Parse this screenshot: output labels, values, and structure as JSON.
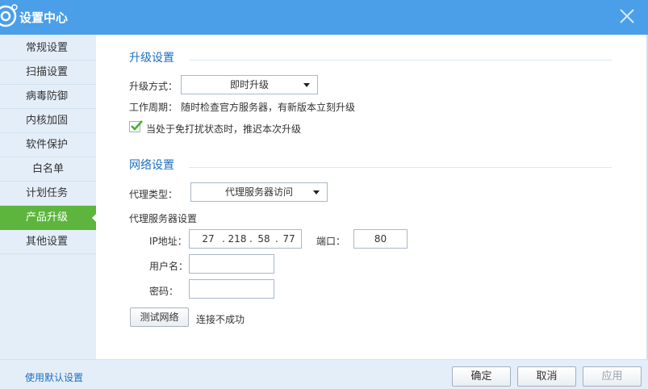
{
  "window": {
    "title": "设置中心",
    "accent_color": "#4a9fe8",
    "active_color": "#5db53d"
  },
  "sidebar": {
    "items": [
      {
        "label": "常规设置"
      },
      {
        "label": "扫描设置"
      },
      {
        "label": "病毒防御"
      },
      {
        "label": "内核加固"
      },
      {
        "label": "软件保护"
      },
      {
        "label": "白名单"
      },
      {
        "label": "计划任务"
      },
      {
        "label": "产品升级",
        "active": true
      },
      {
        "label": "其他设置"
      }
    ]
  },
  "upgrade": {
    "section_title": "升级设置",
    "method_label": "升级方式：",
    "method_value": "即时升级",
    "cycle_label": "工作周期：",
    "cycle_text": "随时检查官方服务器，有新版本立刻升级",
    "defer_checkbox_label": "当处于免打扰状态时，推迟本次升级",
    "defer_checked": true
  },
  "network": {
    "section_title": "网络设置",
    "proxy_type_label": "代理类型：",
    "proxy_type_value": "代理服务器访问",
    "proxy_server_label": "代理服务器设置",
    "ip_label": "IP地址：",
    "ip": [
      "27",
      "218",
      "58",
      "77"
    ],
    "port_label": "端口：",
    "port_value": "80",
    "username_label": "用户名：",
    "username_value": "",
    "password_label": "密码：",
    "password_value": "",
    "test_button": "测试网络",
    "test_status": "连接不成功"
  },
  "footer": {
    "default_link": "使用默认设置",
    "ok": "确定",
    "cancel": "取消",
    "apply": "应用"
  },
  "icons": {
    "logo": "gear-logo-icon",
    "close": "close-icon",
    "dropdown": "caret-down-icon",
    "check": "checkmark-icon"
  }
}
